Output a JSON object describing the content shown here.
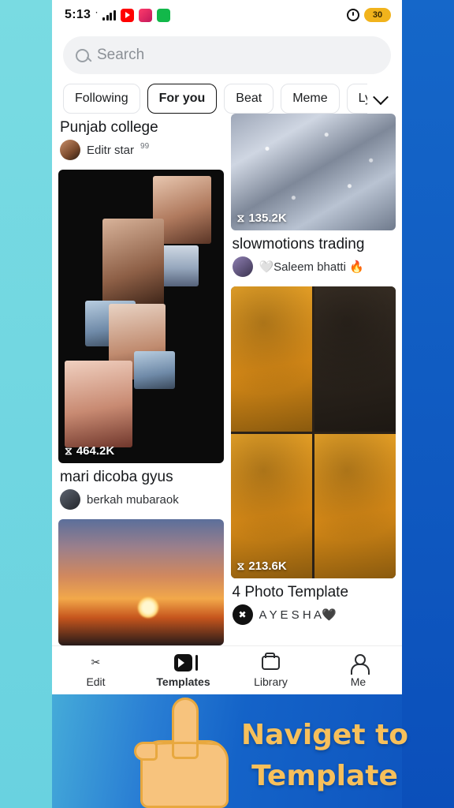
{
  "status_bar": {
    "time": "5:13",
    "signal_icon": "signal-bars-icon",
    "app_icons": [
      "youtube-icon",
      "pink-app-icon",
      "green-app-icon"
    ],
    "alarm_icon": "alarm-clock-icon",
    "battery_level": "30"
  },
  "search": {
    "placeholder": "Search",
    "icon": "search-icon"
  },
  "tabs": {
    "items": [
      {
        "label": "Following",
        "active": false
      },
      {
        "label": "For you",
        "active": true
      },
      {
        "label": "Beat",
        "active": false
      },
      {
        "label": "Meme",
        "active": false
      },
      {
        "label": "Lyric",
        "active": false
      }
    ],
    "expand_icon": "chevron-down-icon"
  },
  "feed": {
    "left_column": [
      {
        "title": "Punjab college",
        "author": "Editr star",
        "author_badge": "99",
        "plays": "",
        "art": "partial-top-card"
      },
      {
        "title": "mari dicoba gyus",
        "author": "berkah mubaraok",
        "author_badge": "",
        "plays": "464.2K",
        "plays_icon": "play-count-icon",
        "art": "photo-collage"
      },
      {
        "title": "",
        "author": "",
        "author_badge": "",
        "plays": "",
        "art": "sunset-landscape"
      }
    ],
    "right_column": [
      {
        "title": "slowmotions trading",
        "author": "🤍Saleem bhatti 🔥",
        "author_badge": "",
        "plays": "135.2K",
        "plays_icon": "play-count-icon",
        "art": "sparkle-fabric"
      },
      {
        "title": "4 Photo Template",
        "author": "A Y E S H A🖤",
        "author_badge": "",
        "plays": "213.6K",
        "plays_icon": "play-count-icon",
        "art": "yellow-dress-grid"
      }
    ]
  },
  "bottom_nav": {
    "items": [
      {
        "label": "Edit",
        "icon": "scissors-icon",
        "active": false
      },
      {
        "label": "Templates",
        "icon": "templates-play-icon",
        "active": true
      },
      {
        "label": "Library",
        "icon": "folder-icon",
        "active": false
      },
      {
        "label": "Me",
        "icon": "person-icon",
        "active": false
      }
    ]
  },
  "overlay": {
    "hand_icon": "pointing-hand-icon",
    "caption_line1": "Naviget to",
    "caption_line2": "Template",
    "caption_color": "#f7c05b"
  }
}
